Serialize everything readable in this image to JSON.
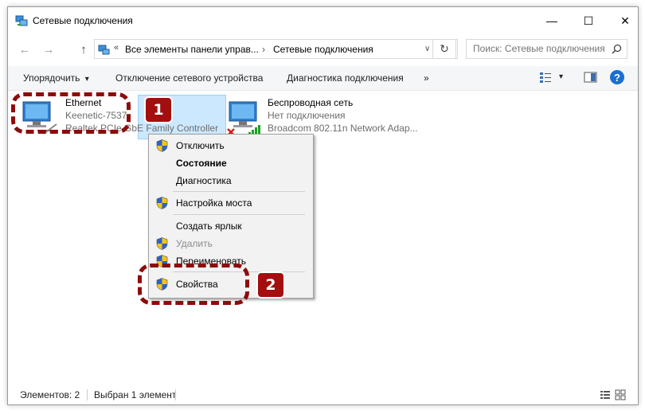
{
  "window": {
    "title": "Сетевые подключения",
    "controls": {
      "minimize": "—",
      "maximize": "☐",
      "close": "✕"
    }
  },
  "navigation": {
    "back_icon": "←",
    "forward_icon": "→",
    "up_icon": "↑",
    "chevron": "«",
    "crumbs": [
      "Все элементы панели управ...",
      "Сетевые подключения"
    ],
    "separator": "›",
    "dropdown_icon": "∨",
    "refresh_icon": "↻",
    "search_placeholder": "Поиск: Сетевые подключения"
  },
  "commandbar": {
    "organize": "Упорядочить",
    "organize_arrow": "▾",
    "disable": "Отключение сетевого устройства",
    "diagnose": "Диагностика подключения",
    "more": "»",
    "view_arrow": "▾",
    "help": "?"
  },
  "items": [
    {
      "name": "Ethernet",
      "status": "Keenetic-7537",
      "adapter": "Realtek PCIe GbE Family Controller"
    },
    {
      "name": "Беспроводная сеть",
      "status": "Нет подключения",
      "adapter": "Broadcom 802.11n Network Adap..."
    }
  ],
  "context_menu": [
    {
      "label": "Отключить",
      "shield": true,
      "style": "normal"
    },
    {
      "label": "Состояние",
      "shield": false,
      "style": "bold"
    },
    {
      "label": "Диагностика",
      "shield": false,
      "style": "normal"
    },
    {
      "label": "Настройка моста",
      "shield": true,
      "style": "normal"
    },
    {
      "label": "Создать ярлык",
      "shield": false,
      "style": "normal"
    },
    {
      "label": "Удалить",
      "shield": true,
      "style": "disabled"
    },
    {
      "label": "Переименовать",
      "shield": true,
      "style": "normal"
    },
    {
      "label": "Свойства",
      "shield": true,
      "style": "normal"
    }
  ],
  "annotations": {
    "badge1": "1",
    "badge2": "2"
  },
  "statusbar": {
    "count": "Элементов: 2",
    "selected": "Выбран 1 элемент"
  },
  "colors": {
    "annotation_red": "#a40e0e",
    "selection": "#cce8ff",
    "help_blue": "#1a6fcf"
  }
}
